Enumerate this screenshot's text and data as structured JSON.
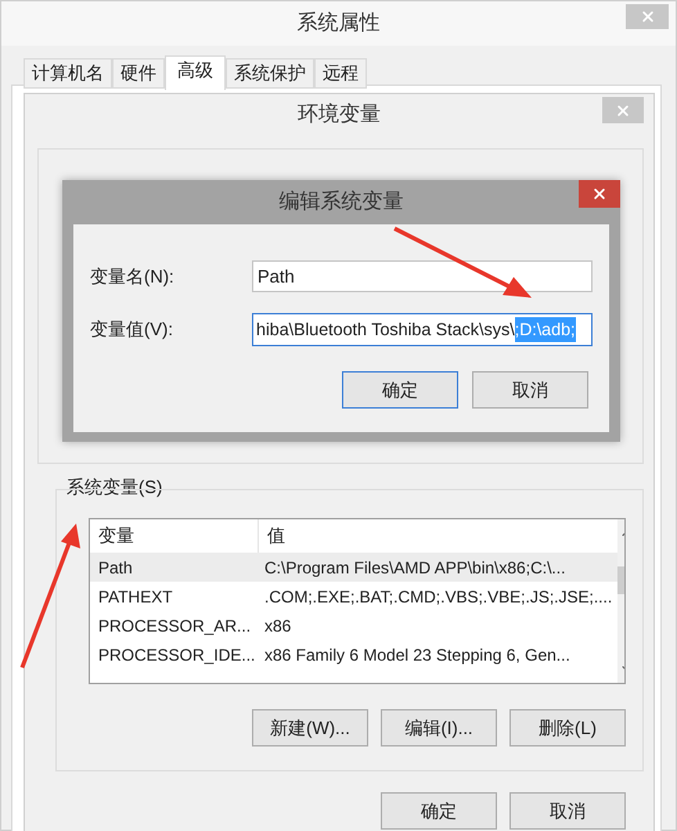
{
  "window": {
    "title": "系统属性"
  },
  "tabs": [
    {
      "label": "计算机名",
      "selected": false
    },
    {
      "label": "硬件",
      "selected": false
    },
    {
      "label": "高级",
      "selected": true
    },
    {
      "label": "系统保护",
      "selected": false
    },
    {
      "label": "远程",
      "selected": false
    }
  ],
  "env_window": {
    "title": "环境变量"
  },
  "edit_dialog": {
    "title": "编辑系统变量",
    "name_label": "变量名(N):",
    "name_value": "Path",
    "value_label": "变量值(V):",
    "value_text": "hiba\\Bluetooth Toshiba Stack\\sys\\",
    "value_selection": ";D:\\adb;",
    "buttons": [
      {
        "label": "确定",
        "default": true
      },
      {
        "label": "取消",
        "default": false
      }
    ]
  },
  "system_variables": {
    "title": "系统变量(S)",
    "columns": [
      "变量",
      "值"
    ],
    "rows": [
      {
        "name": "Path",
        "value": "C:\\Program Files\\AMD APP\\bin\\x86;C:\\...",
        "selected": true
      },
      {
        "name": "PATHEXT",
        "value": ".COM;.EXE;.BAT;.CMD;.VBS;.VBE;.JS;.JSE;....",
        "selected": false
      },
      {
        "name": "PROCESSOR_AR...",
        "value": "x86",
        "selected": false
      },
      {
        "name": "PROCESSOR_IDE...",
        "value": "x86 Family 6 Model 23 Stepping 6, Gen...",
        "selected": false
      }
    ],
    "buttons": [
      "新建(W)...",
      "编辑(I)...",
      "删除(L)"
    ]
  },
  "footer_buttons": [
    "确定",
    "取消"
  ]
}
